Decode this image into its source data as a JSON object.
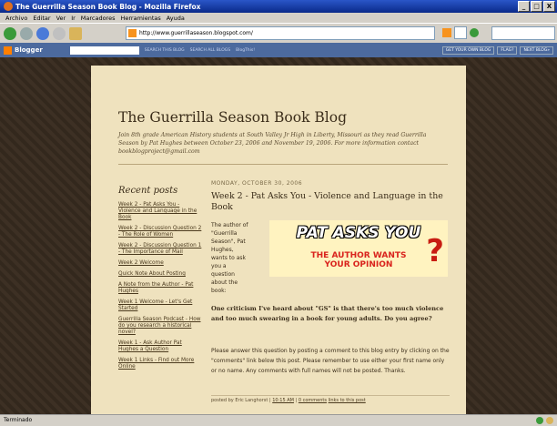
{
  "window": {
    "title": "The Guerrilla Season Book Blog - Mozilla Firefox",
    "controls": [
      "_",
      "□",
      "X"
    ]
  },
  "menu": [
    "Archivo",
    "Editar",
    "Ver",
    "Ir",
    "Marcadores",
    "Herramientas",
    "Ayuda"
  ],
  "address": {
    "url": "http://www.guerrillaseason.blogspot.com/"
  },
  "blogger_bar": {
    "logo": "Blogger",
    "search_this": "SEARCH THIS BLOG",
    "search_all": "SEARCH ALL BLOGS",
    "blogthis": "BlogThis!",
    "get_own": "GET YOUR OWN BLOG",
    "flag": "FLAG?",
    "next": "NEXT BLOG»"
  },
  "blog": {
    "title": "The Guerrilla Season Book Blog",
    "description": "Join 8th grade American History students at South Valley Jr High in Liberty, Missouri as they read Guerrilla Season by Pat Hughes between October 23, 2006 and November 19, 2006. For more information contact bookblogproject@gmail.com"
  },
  "sidebar": {
    "heading": "Recent posts",
    "items": [
      "Week 2 - Pat Asks You - Violence and Language in the Book",
      "Week 2 - Discussion Question 2 - The Role of Women",
      "Week 2 - Discussion Question 1 - The Importance of Mail",
      "Week 2 Welcome",
      "Quick Note About Posting",
      "A Note from the Author - Pat Hughes",
      "Week 1 Welcome - Let's Get Started",
      "Guerrilla Season Podcast - How do you research a historical novel?",
      "Week 1 - Ask Author Pat Hughes a Question",
      "Week 1 Links - Find out More Online"
    ]
  },
  "post": {
    "date": "MONDAY, OCTOBER 30, 2006",
    "title": "Week 2 - Pat Asks You - Violence and Language in the Book",
    "intro": "The author of \"Guerrilla Season\", Pat Hughes, wants to ask you a question about the book:",
    "banner_line1": "PAT ASKS YOU",
    "banner_line2a": "THE AUTHOR WANTS",
    "banner_line2b": "YOUR OPINION",
    "banner_mark": "?",
    "question": "One criticism I've heard about \"GS\" is that there's too much violence and too much swearing in a book for young adults. Do you agree?",
    "body": "Please answer this question by posting a comment to this blog entry by clicking on the \"comments\" link below this post. Please remember to use either your first name only or no name. Any comments with full names will not be posted. Thanks.",
    "footer_posted": "posted by Eric Langhorst |",
    "footer_time": "10:15 AM",
    "footer_comments": "0 comments",
    "footer_links": "links to this post"
  },
  "status": {
    "text": "Terminado"
  }
}
